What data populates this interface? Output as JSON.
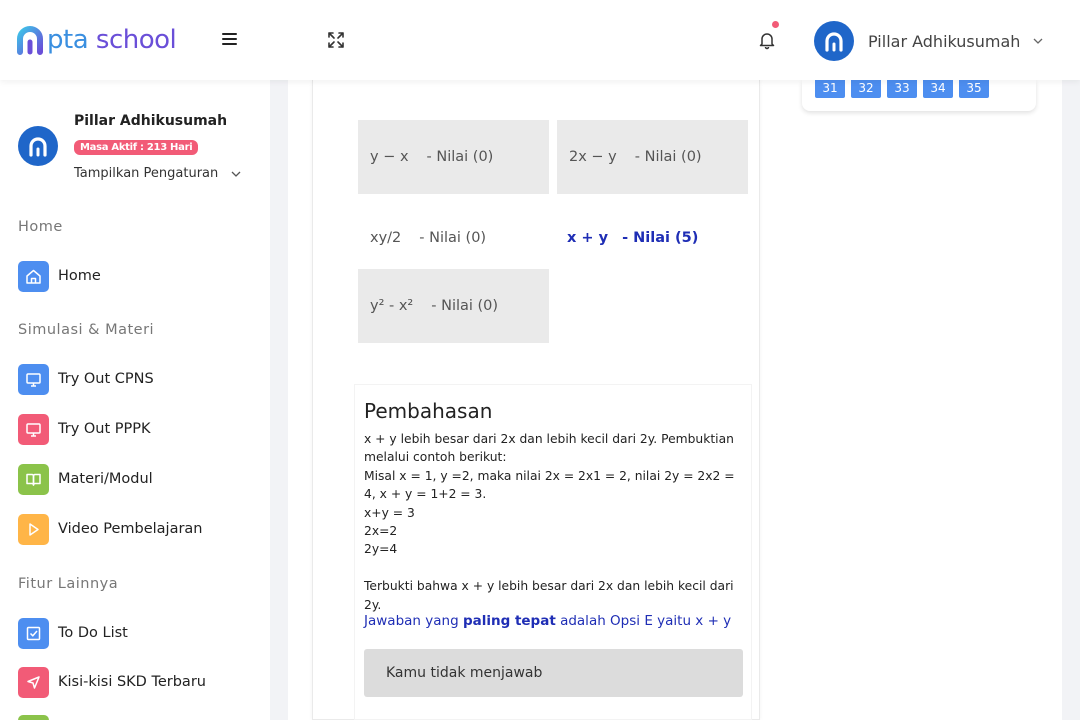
{
  "header": {
    "logo_prefix": "pta",
    "logo_suffix": " school",
    "user_name": "Pillar Adhikusumah"
  },
  "sidebar": {
    "profile_name": "Pillar Adhikusumah",
    "badge": "Masa Aktif : 213 Hari",
    "settings": "Tampilkan Pengaturan",
    "sections": [
      "Home",
      "Simulasi & Materi",
      "Fitur Lainnya"
    ],
    "items": [
      {
        "label": "Home",
        "icon": "home-icon",
        "color": "#4d8ef0"
      },
      {
        "label": "Try Out CPNS",
        "icon": "monitor-icon",
        "color": "#4d8ef0"
      },
      {
        "label": "Try Out PPPK",
        "icon": "monitor-icon",
        "color": "#f25b77"
      },
      {
        "label": "Materi/Modul",
        "icon": "book-icon",
        "color": "#8bc34a"
      },
      {
        "label": "Video Pembelajaran",
        "icon": "play-icon",
        "color": "#ffb547"
      },
      {
        "label": "To Do List",
        "icon": "checkbox-icon",
        "color": "#4d8ef0"
      },
      {
        "label": "Kisi-kisi SKD Terbaru",
        "icon": "send-icon",
        "color": "#f25b77"
      }
    ]
  },
  "question": {
    "options": [
      {
        "expr": "y − x",
        "score": "- Nilai (0)"
      },
      {
        "expr": "2x − y",
        "score": "- Nilai (0)"
      },
      {
        "expr": "xy/2",
        "score": "- Nilai (0)"
      },
      {
        "expr": "x + y",
        "score": "- Nilai (5)"
      },
      {
        "expr": "y² - x²",
        "score": "- Nilai (0)"
      }
    ]
  },
  "explanation": {
    "title": "Pembahasan",
    "lines": [
      "x + y lebih besar dari 2x dan lebih kecil dari 2y. Pembuktian melalui contoh berikut:",
      "Misal x = 1, y =2, maka nilai 2x = 2x1 = 2, nilai 2y = 2x2 = 4, x + y = 1+2 = 3.",
      "x+y = 3",
      "2x=2",
      "2y=4",
      "",
      "Terbukti bahwa x + y lebih besar dari 2x dan lebih kecil dari 2y."
    ],
    "answer_prefix": "Jawaban yang ",
    "answer_bold": "paling tepat",
    "answer_suffix": " adalah Opsi E yaitu x + y",
    "no_answer": "Kamu tidak menjawab"
  },
  "numbers": [
    "31",
    "32",
    "33",
    "34",
    "35"
  ],
  "colors": {
    "primary": "#4d8ef0",
    "accent": "#f25b77",
    "correct": "#1f2eb5",
    "green": "#8bc34a",
    "orange": "#ffb547"
  }
}
